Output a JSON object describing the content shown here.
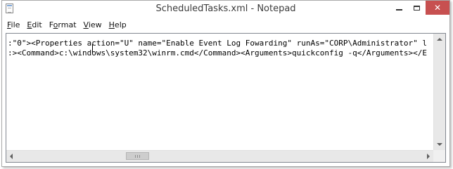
{
  "window": {
    "title": "ScheduledTasks.xml - Notepad",
    "controls": {
      "minimize_icon": "minimize-icon",
      "maximize_icon": "maximize-icon",
      "close_glyph": "✕"
    }
  },
  "menu": {
    "items": [
      {
        "label": "File",
        "accel": "F",
        "rest": "ile"
      },
      {
        "label": "Edit",
        "accel": "E",
        "rest": "dit"
      },
      {
        "label": "Format",
        "accel": "o",
        "pre": "F",
        "rest": "rmat"
      },
      {
        "label": "View",
        "accel": "V",
        "rest": "iew"
      },
      {
        "label": "Help",
        "accel": "H",
        "rest": "elp"
      }
    ]
  },
  "editor": {
    "lines": [
      ":\"0\"><Properties action=\"U\" name=\"Enable Event Log Fowarding\" runAs=\"CORP\\Administrator\" l",
      ":><Command>c:\\windows\\system32\\winrm.cmd</Command><Arguments>quickconfig -q</Arguments></E"
    ]
  },
  "colors": {
    "close_button": "#c75050",
    "border": "#a9a9a9",
    "scrollbar_track": "#e8e8e8"
  }
}
